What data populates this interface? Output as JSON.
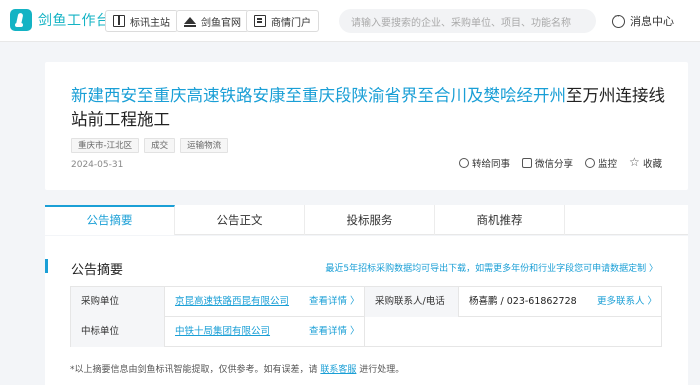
{
  "app": {
    "name": "剑鱼工作台"
  },
  "nav": [
    {
      "label": "标讯主站",
      "icon": "book-icon"
    },
    {
      "label": "剑鱼官网",
      "icon": "crown-icon"
    },
    {
      "label": "商情门户",
      "icon": "document-icon"
    }
  ],
  "search": {
    "placeholder": "请输入要搜索的企业、采购单位、项目、功能名称"
  },
  "messages": {
    "label": "消息中心",
    "icon": "message-icon"
  },
  "notice": {
    "title_highlight": "新建西安至重庆高速铁路安康至重庆段陕渝省界至合川及樊哙经开州",
    "title_rest": "至万州连接线站前工程施工",
    "tags": [
      "重庆市-江北区",
      "成交",
      "运输物流"
    ],
    "date": "2024-05-31",
    "actions": [
      {
        "label": "转给同事",
        "icon": "share-person-icon"
      },
      {
        "label": "微信分享",
        "icon": "wechat-icon"
      },
      {
        "label": "监控",
        "icon": "monitor-icon"
      },
      {
        "label": "收藏",
        "icon": "star-icon"
      }
    ]
  },
  "tabs": [
    "公告摘要",
    "公告正文",
    "投标服务",
    "商机推荐"
  ],
  "summary": {
    "title": "公告摘要",
    "data_link": "最近5年招标采购数据均可导出下载，如需更多年份和行业字段您可申请数据定制 〉",
    "rows": [
      {
        "label": "采购单位",
        "value": "京昆高速铁路西昆有限公司",
        "more": "查看详情 〉",
        "label2": "采购联系人/电话",
        "value2": "杨喜鹏 / 023-61862728",
        "more2": "更多联系人 〉"
      },
      {
        "label": "中标单位",
        "value": "中铁十局集团有限公司",
        "more": "查看详情 〉"
      }
    ],
    "footnote_pre": "*以上摘要信息由剑鱼标讯智能提取，仅供参考。如有误差，请",
    "footnote_link": "联系客服",
    "footnote_post": "进行处理。"
  },
  "colors": {
    "accent": "#1a9fd6",
    "brand": "#14b3c4"
  }
}
